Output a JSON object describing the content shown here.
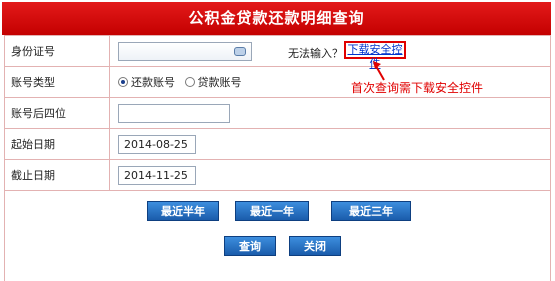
{
  "header": {
    "title": "公积金贷款还款明细查询"
  },
  "form": {
    "id_label": "身份证号",
    "id_value": "",
    "cannot_input": "无法输入？",
    "download_link": "下载安全控件",
    "account_type_label": "账号类型",
    "account_type_options": [
      "还款账号",
      "贷款账号"
    ],
    "account_type_selected": "还款账号",
    "last4_label": "账号后四位",
    "last4_value": "",
    "start_label": "起始日期",
    "start_value": "2014-08-25",
    "end_label": "截止日期",
    "end_value": "2014-11-25"
  },
  "annotation": {
    "text": "首次查询需下载安全控件",
    "color": "#e00000"
  },
  "buttons": {
    "half_year": "最近半年",
    "one_year": "最近一年",
    "three_years": "最近三年",
    "query": "查询",
    "close": "关闭"
  },
  "colors": {
    "header": "#d10000",
    "button": "#2a6fc0",
    "border": "#e3b2b2"
  }
}
